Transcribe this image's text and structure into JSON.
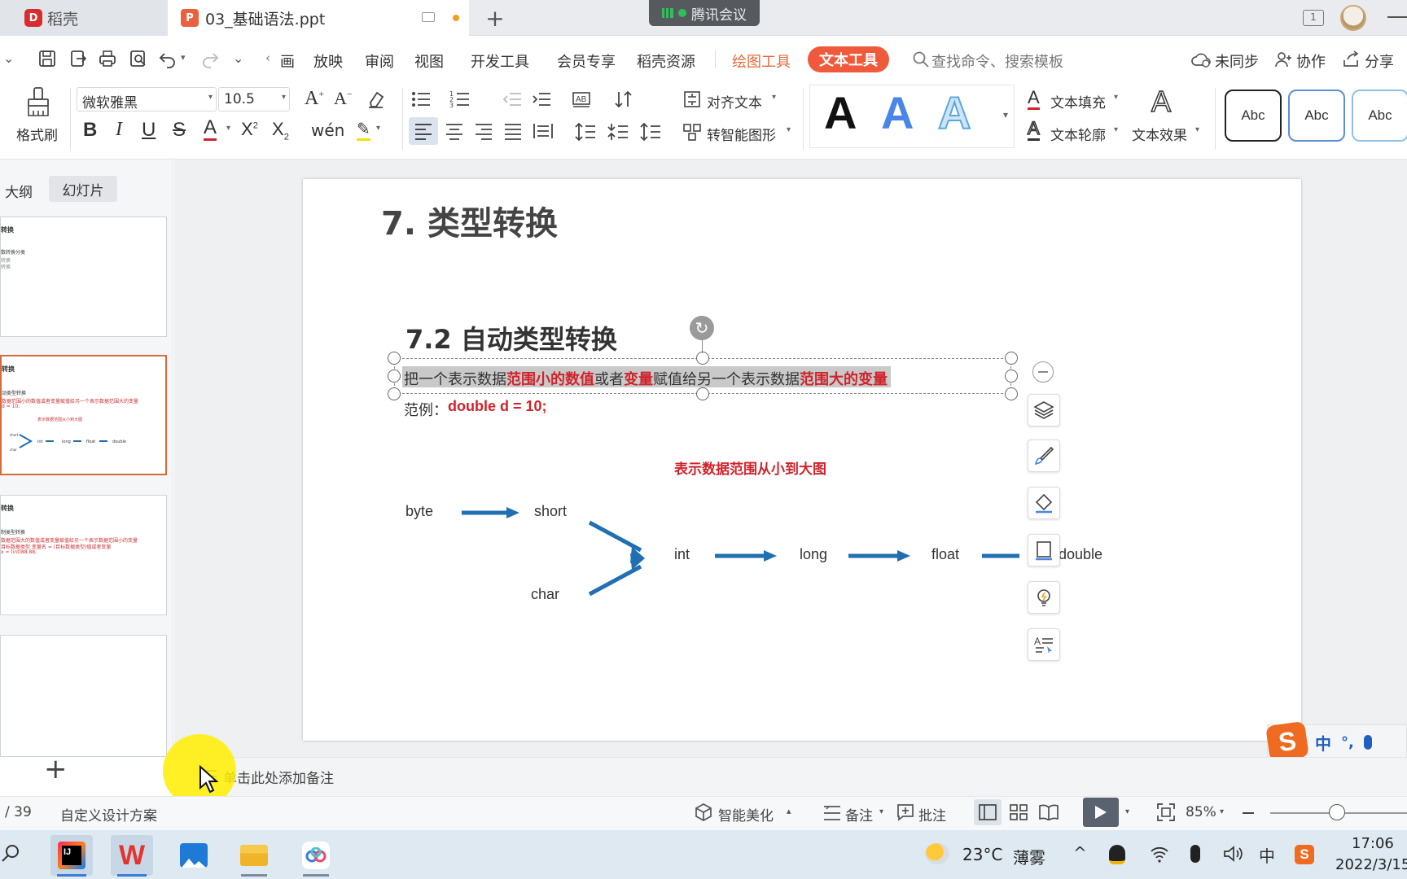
{
  "titlebar": {
    "tab_inactive": "稻壳",
    "tab_active": "03_基础语法.ppt",
    "meeting": "腾讯会议"
  },
  "menubar": {
    "items": [
      "画",
      "放映",
      "审阅",
      "视图",
      "开发工具",
      "会员专享",
      "稻壳资源",
      "绘图工具",
      "文本工具"
    ],
    "search_placeholder": "查找命令、搜索模板",
    "sync": "未同步",
    "collab": "协作",
    "share": "分享"
  },
  "toolbar": {
    "format_painter": "格式刷",
    "font_name": "微软雅黑",
    "font_size": "10.5",
    "align_text": "对齐文本",
    "smart_art": "转智能图形",
    "text_fill": "文本填充",
    "text_outline": "文本轮廓",
    "text_effect": "文本效果",
    "style_sample": "A",
    "abc_sample": "Abc"
  },
  "leftpanel": {
    "tab_outline": "大纲",
    "tab_slides": "幻灯片"
  },
  "slide": {
    "title": "7. 类型转换",
    "subtitle": "7.2 自动类型转换",
    "desc_parts": [
      "把一个表示数据",
      "范围小的数值",
      "或者",
      "变量",
      "赋值给另一个表示数据",
      "范围大的变量"
    ],
    "example_label": "范例：",
    "example_code": "double d = 10;",
    "caption": "表示数据范围从小到大图",
    "types": [
      "byte",
      "short",
      "char",
      "int",
      "long",
      "float",
      "double"
    ]
  },
  "notes": {
    "placeholder": "单击此处添加备注"
  },
  "statusbar": {
    "page": "/ 39",
    "theme": "自定义设计方案",
    "beautify": "智能美化",
    "notes": "备注",
    "comment": "批注",
    "zoom": "85%"
  },
  "taskbar": {
    "weather_temp": "23°C",
    "weather_desc": "薄雾",
    "ime": "中",
    "time": "17:06",
    "date": "2022/3/15"
  },
  "ime_bar": {
    "label": "中"
  },
  "colors": {
    "accent_red": "#d0232b",
    "arrow_blue": "#1f6fb2",
    "wps_tab_orange": "#ee5a3b"
  }
}
